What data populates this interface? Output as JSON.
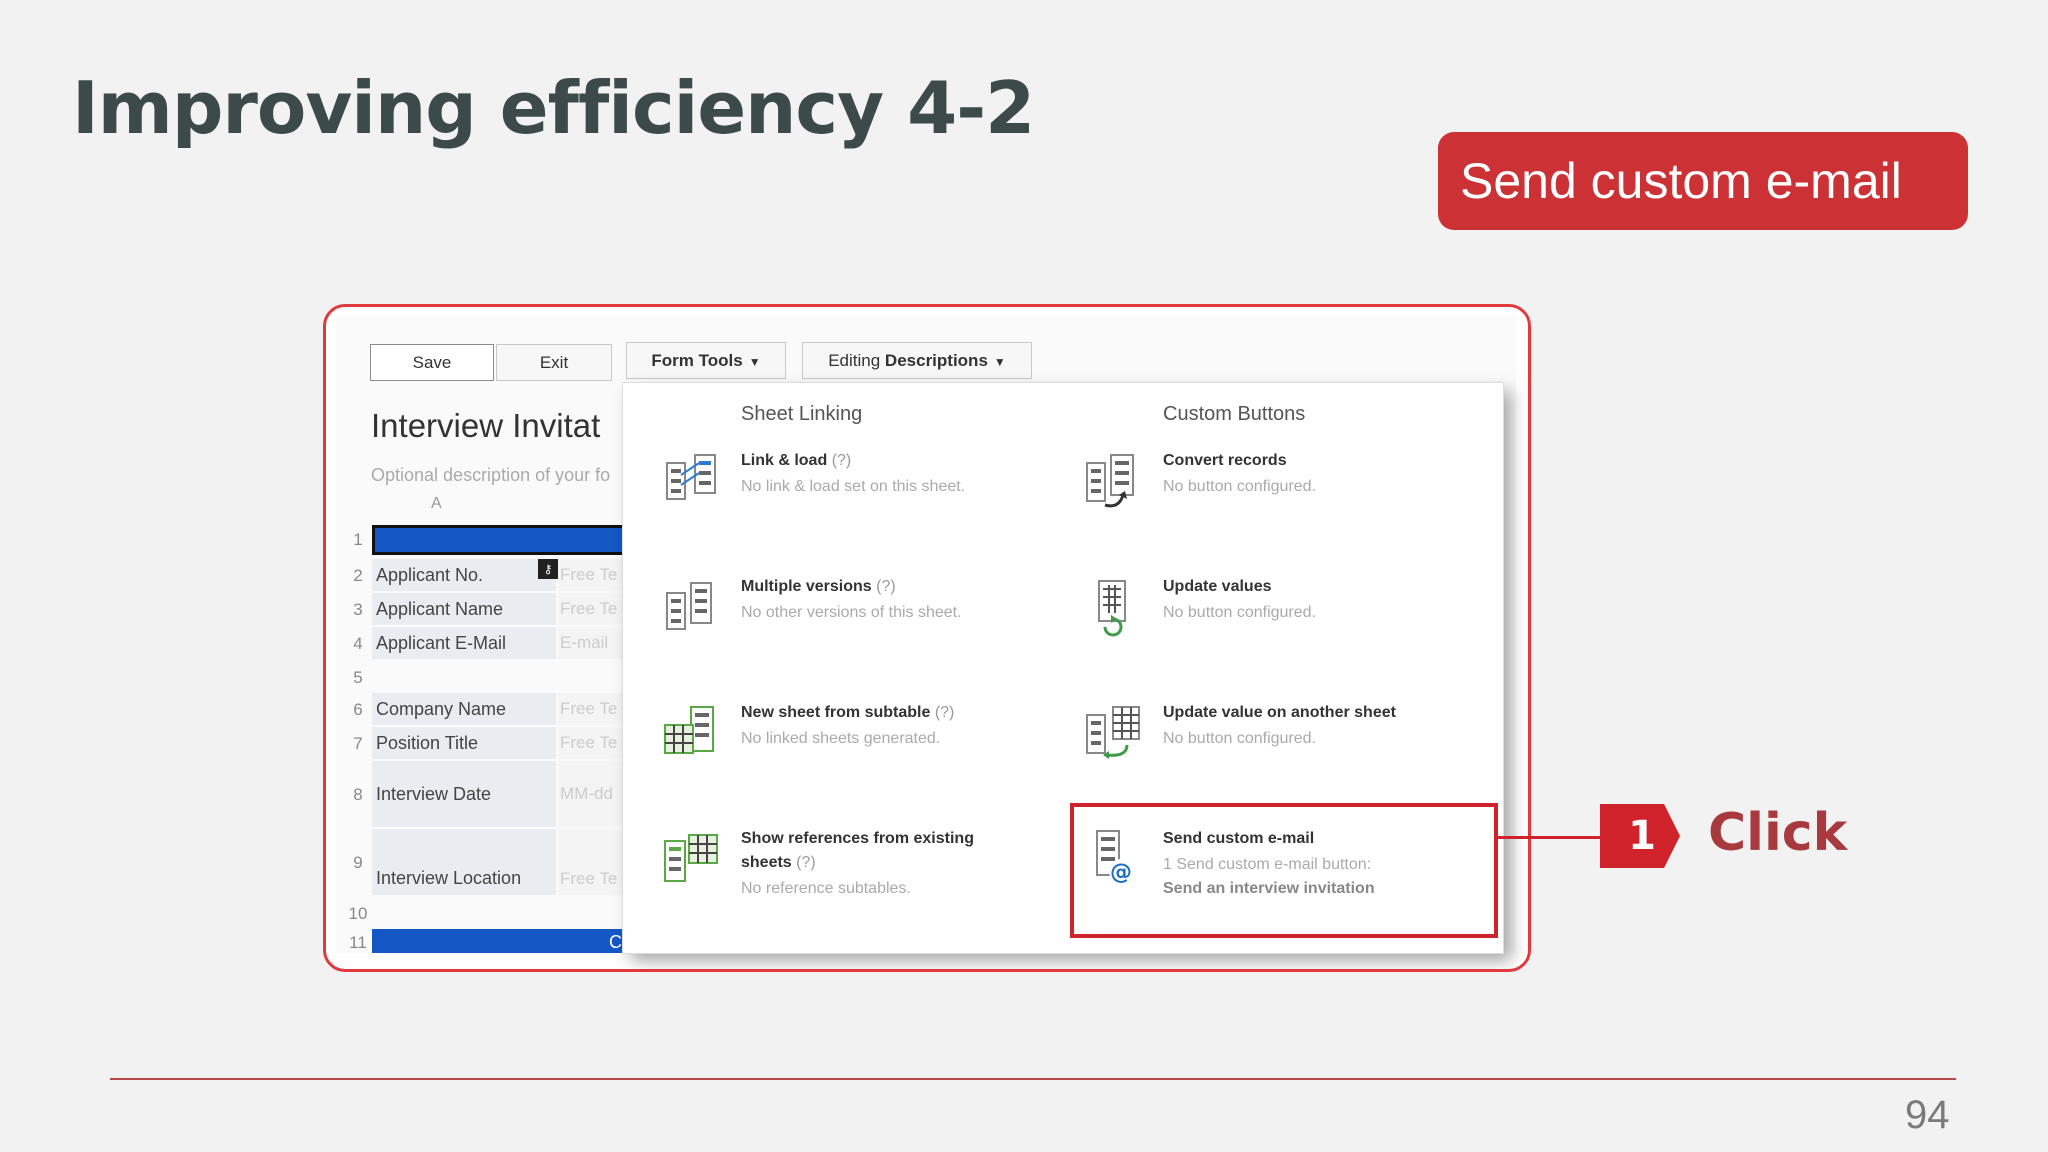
{
  "slide": {
    "title": "Improving efficiency 4-2",
    "badge": "Send custom e-mail",
    "page_number": "94",
    "step_number": "1",
    "click_label": "Click",
    "colors": {
      "accent": "#cc3235",
      "title": "#3d4a4a",
      "highlight": "#d0222a"
    }
  },
  "toolbar": {
    "save": "Save",
    "exit": "Exit",
    "form_tools": "Form Tools",
    "editing_prefix": "Editing",
    "editing_bold": "Descriptions"
  },
  "form": {
    "title": "Interview Invitat",
    "description": "Optional description of your fo",
    "column_header": "A",
    "rows": [
      {
        "num": "1",
        "label": "",
        "value": ""
      },
      {
        "num": "2",
        "label": "Applicant No.",
        "value": "Free Te"
      },
      {
        "num": "3",
        "label": "Applicant Name",
        "value": "Free Te"
      },
      {
        "num": "4",
        "label": "Applicant E-Mail",
        "value": "E-mail"
      },
      {
        "num": "5",
        "label": "",
        "value": ""
      },
      {
        "num": "6",
        "label": "Company Name",
        "value": "Free Te"
      },
      {
        "num": "7",
        "label": "Position Title",
        "value": "Free Te"
      },
      {
        "num": "8",
        "label": "Interview Date",
        "value": "MM-dd"
      },
      {
        "num": "9",
        "label": "Interview Location",
        "value": "Free Te"
      },
      {
        "num": "10",
        "label": "",
        "value": ""
      },
      {
        "num": "11",
        "label": "",
        "value": "C"
      }
    ]
  },
  "dropdown": {
    "sheet_linking": {
      "heading": "Sheet Linking",
      "items": [
        {
          "name": "Link & load",
          "q": "(?)",
          "sub": "No link & load set on this sheet.",
          "icon": "link-load-icon"
        },
        {
          "name": "Multiple versions",
          "q": "(?)",
          "sub": "No other versions of this sheet.",
          "icon": "multiple-versions-icon"
        },
        {
          "name": "New sheet from subtable",
          "q": "(?)",
          "sub": "No linked sheets generated.",
          "icon": "subtable-icon"
        },
        {
          "name": "Show references from existing",
          "name2": "sheets",
          "q": "(?)",
          "sub": "No reference subtables.",
          "icon": "references-icon"
        }
      ]
    },
    "custom_buttons": {
      "heading": "Custom Buttons",
      "items": [
        {
          "name": "Convert records",
          "sub": "No button configured.",
          "icon": "convert-records-icon"
        },
        {
          "name": "Update values",
          "sub": "No button configured.",
          "icon": "update-values-icon"
        },
        {
          "name": "Update value on another sheet",
          "sub": "No button configured.",
          "icon": "update-another-sheet-icon"
        },
        {
          "name": "Send custom e-mail",
          "sub": "1 Send custom e-mail button:",
          "sub2": "Send an interview invitation",
          "icon": "send-email-icon"
        }
      ]
    }
  }
}
